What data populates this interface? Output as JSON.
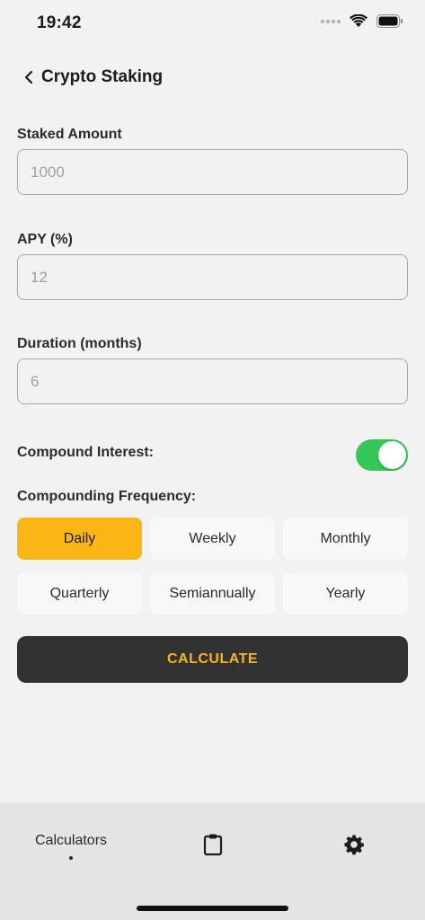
{
  "status_bar": {
    "time": "19:42"
  },
  "header": {
    "title": "Crypto Staking",
    "back_icon": "chevron-left-icon"
  },
  "form": {
    "staked_amount": {
      "label": "Staked Amount",
      "placeholder": "1000"
    },
    "apy": {
      "label": "APY (%)",
      "placeholder": "12"
    },
    "duration": {
      "label": "Duration (months)",
      "placeholder": "6"
    }
  },
  "compound": {
    "label": "Compound Interest:",
    "enabled": true,
    "toggle_color": "#34c759"
  },
  "frequency": {
    "label": "Compounding Frequency:",
    "selected": "Daily",
    "options": [
      "Daily",
      "Weekly",
      "Monthly",
      "Quarterly",
      "Semiannually",
      "Yearly"
    ]
  },
  "calculate_button": {
    "label": "CALCULATE"
  },
  "tab_bar": {
    "calculators_label": "Calculators",
    "clipboard_icon": "clipboard-icon",
    "settings_icon": "gear-icon"
  },
  "colors": {
    "accent": "#fbb515",
    "button_bg": "#323232",
    "background": "#f2f2f2"
  }
}
